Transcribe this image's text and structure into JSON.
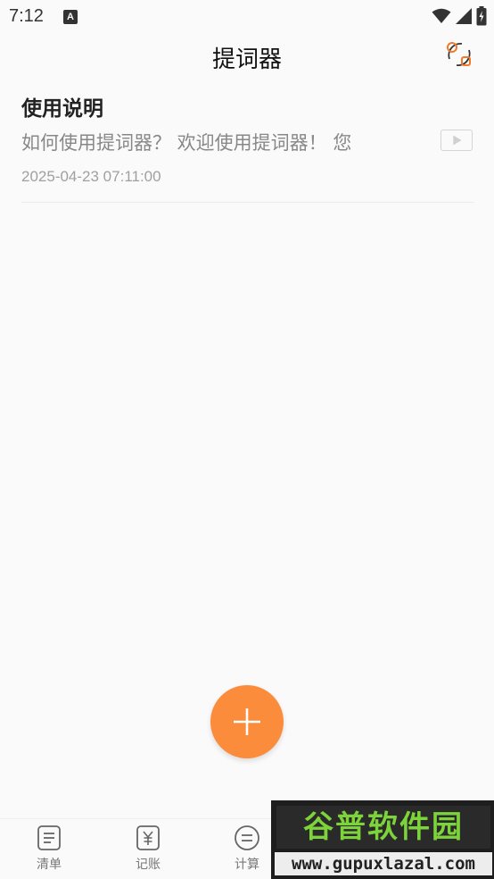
{
  "status_bar": {
    "time": "7:12",
    "notification_icon": "A"
  },
  "header": {
    "title": "提词器",
    "sync_icon": "sync-icon"
  },
  "notes": [
    {
      "title": "使用说明",
      "preview": "如何使用提词器？ 欢迎使用提词器！ 您",
      "date": "2025-04-23 07:11:00"
    }
  ],
  "fab": {
    "icon": "plus-icon"
  },
  "bottom_nav": [
    {
      "label": "清单",
      "icon": "list-icon"
    },
    {
      "label": "记账",
      "icon": "yuan-icon"
    },
    {
      "label": "计算",
      "icon": "calculator-icon"
    }
  ],
  "watermark": {
    "brand": "谷普软件园",
    "url": "www.gupuxlazal.com"
  },
  "colors": {
    "accent": "#fb8c3c",
    "background": "#fafafa",
    "watermark_green": "#7dd33a"
  }
}
